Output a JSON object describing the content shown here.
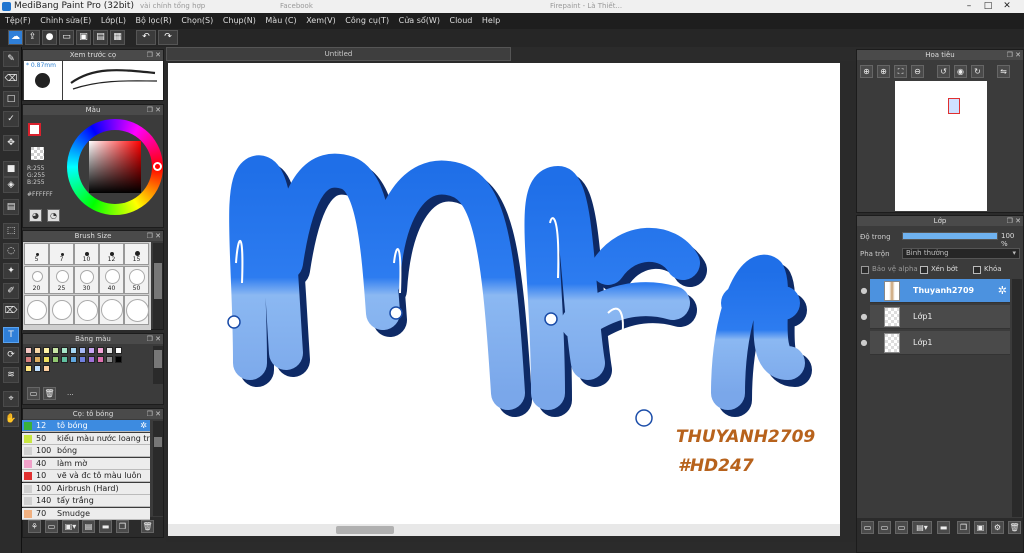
{
  "window": {
    "title": "MediBang Paint Pro (32bit)",
    "ghost_tabs": [
      "Facebook",
      "Firepaint - Là Thiết...",
      "vài chính tổng hợp"
    ],
    "controls": [
      "–",
      "□",
      "✕"
    ]
  },
  "menu": [
    "Tệp(F)",
    "Chỉnh sửa(E)",
    "Lớp(L)",
    "Bộ lọc(R)",
    "Chọn(S)",
    "Chụp(N)",
    "Màu (C)",
    "Xem(V)",
    "Công cụ(T)",
    "Cửa sổ(W)",
    "Cloud",
    "Help"
  ],
  "toolbar_icons": [
    "cloud-icon",
    "upload-icon",
    "chat-icon",
    "document-icon",
    "save-icon",
    "layout-icon",
    "grid-icon",
    "undo-icon",
    "redo-icon"
  ],
  "left_tools": [
    {
      "name": "brush-tool-icon",
      "glyph": "✎"
    },
    {
      "name": "eraser-tool-icon",
      "glyph": "⌫"
    },
    {
      "name": "rectangle-select-icon",
      "glyph": "□"
    },
    {
      "name": "pen-tool-icon",
      "glyph": "✓"
    },
    {
      "name": "move-tool-icon",
      "glyph": "✥"
    },
    {
      "name": "fill-rect-icon",
      "glyph": "■"
    },
    {
      "name": "bucket-tool-icon",
      "glyph": "◈"
    },
    {
      "name": "gradient-tool-icon",
      "glyph": "▤"
    },
    {
      "name": "select-tool-icon",
      "glyph": "⬚"
    },
    {
      "name": "lasso-tool-icon",
      "glyph": "◌"
    },
    {
      "name": "magic-wand-icon",
      "glyph": "✦"
    },
    {
      "name": "select-pen-icon",
      "glyph": "✐"
    },
    {
      "name": "select-eraser-icon",
      "glyph": "⌦"
    },
    {
      "name": "text-tool-icon",
      "glyph": "T"
    },
    {
      "name": "operation-tool-icon",
      "glyph": "⟳"
    },
    {
      "name": "blur-tool-icon",
      "glyph": "≋"
    },
    {
      "name": "eyedropper-icon",
      "glyph": "⌖"
    },
    {
      "name": "hand-tool-icon",
      "glyph": "✋"
    }
  ],
  "brush_preview": {
    "title": "Xem trước cọ",
    "size": "0.87mm"
  },
  "color_panel": {
    "title": "Màu",
    "r": "R:255",
    "g": "G:255",
    "b": "B:255",
    "hex": "#FFFFFF",
    "foreground": "#ffffff",
    "background_outline": "#d9212d"
  },
  "brush_size": {
    "title": "Brush Size",
    "sizes": [
      "5",
      "7",
      "10",
      "12",
      "15",
      "20",
      "25",
      "30",
      "40",
      "50"
    ]
  },
  "palette": {
    "title": "Bảng màu",
    "colors": [
      "#f4c7c3",
      "#f8d7a6",
      "#fff3a6",
      "#c8e6a6",
      "#a6e6c8",
      "#a6d8f4",
      "#a6b8f4",
      "#c8a6f4",
      "#f4a6d8",
      "#e0e0e0",
      "#ffffff",
      "#d88080",
      "#e0b060",
      "#f0e060",
      "#90c870",
      "#60c0a0",
      "#60a8e0",
      "#7080e0",
      "#a070d8",
      "#e070b0",
      "#909090",
      "#000000",
      "#ffe680",
      "#c0e0ff",
      "#ffd0a0"
    ],
    "more": "..."
  },
  "brush_list": {
    "title": "Cọ: tô bóng",
    "items": [
      {
        "color": "#3ab03a",
        "size": "12",
        "name": "tô bóng",
        "selected": true
      },
      {
        "color": "#c8e640",
        "size": "50",
        "name": "kiểu màu nước loang trên"
      },
      {
        "color": "#d0d0d0",
        "size": "100",
        "name": "bóng"
      },
      {
        "color": "#f0a0c8",
        "size": "40",
        "name": "làm mờ"
      },
      {
        "color": "#e03030",
        "size": "10",
        "name": "vẽ và đc tô màu luôn"
      },
      {
        "color": "#d0d0d0",
        "size": "100",
        "name": "Airbrush (Hard)"
      },
      {
        "color": "#d0d0d0",
        "size": "140",
        "name": "tẩy trắng"
      },
      {
        "color": "#f0b080",
        "size": "70",
        "name": "Smudge"
      }
    ]
  },
  "document": {
    "tab_title": "Untitled"
  },
  "artwork": {
    "word": "Mệt",
    "signature_line1": "THUYANH2709",
    "signature_line2": "#HD247"
  },
  "navigator": {
    "title": "Hoa tiêu",
    "icons": [
      "zoom-in-icon",
      "zoom-out-icon",
      "fit-icon",
      "zoom-minus-icon",
      "rotate-left-icon",
      "reset-icon",
      "rotate-right-icon",
      "flip-icon"
    ]
  },
  "layers": {
    "title": "Lớp",
    "opacity_label": "Độ trong",
    "opacity_value": "100 %",
    "opacity_fraction": 1.0,
    "blend_label": "Pha trộn",
    "blend_value": "Bình thường",
    "protect_alpha": "Bảo vệ alpha",
    "clipping": "Xén bớt",
    "lock": "Khóa",
    "items": [
      {
        "name": "Thuyanh2709",
        "selected": true
      },
      {
        "name": "Lớp1"
      },
      {
        "name": "Lớp1"
      }
    ]
  }
}
